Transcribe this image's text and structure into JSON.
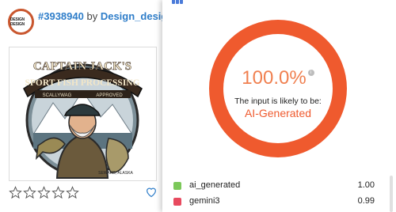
{
  "design_card": {
    "design_id": "#3938940",
    "by_text": "by",
    "designer_name": "Design_design",
    "avatar_text": "DESIGN DESIGN",
    "artwork": {
      "title_line1": "CAPTAIN JACK'S",
      "title_line2": "SPORT FISH PROCESSING",
      "banner_left": "SCALLYWAG",
      "banner_right": "APPROVED",
      "location": "SEWARD, ALASKA"
    },
    "rating_stars": 0,
    "rating_max": 5
  },
  "detector": {
    "score": "100.0%",
    "info_glyph": "i",
    "likely_text": "The input is likely to be:",
    "verdict": "AI-Generated",
    "accent_color": "#ef5a2e",
    "results": [
      {
        "label": "ai_generated",
        "value": "1.00",
        "color": "#7cc85a"
      },
      {
        "label": "gemini3",
        "value": "0.99",
        "color": "#e84a5f"
      }
    ]
  }
}
